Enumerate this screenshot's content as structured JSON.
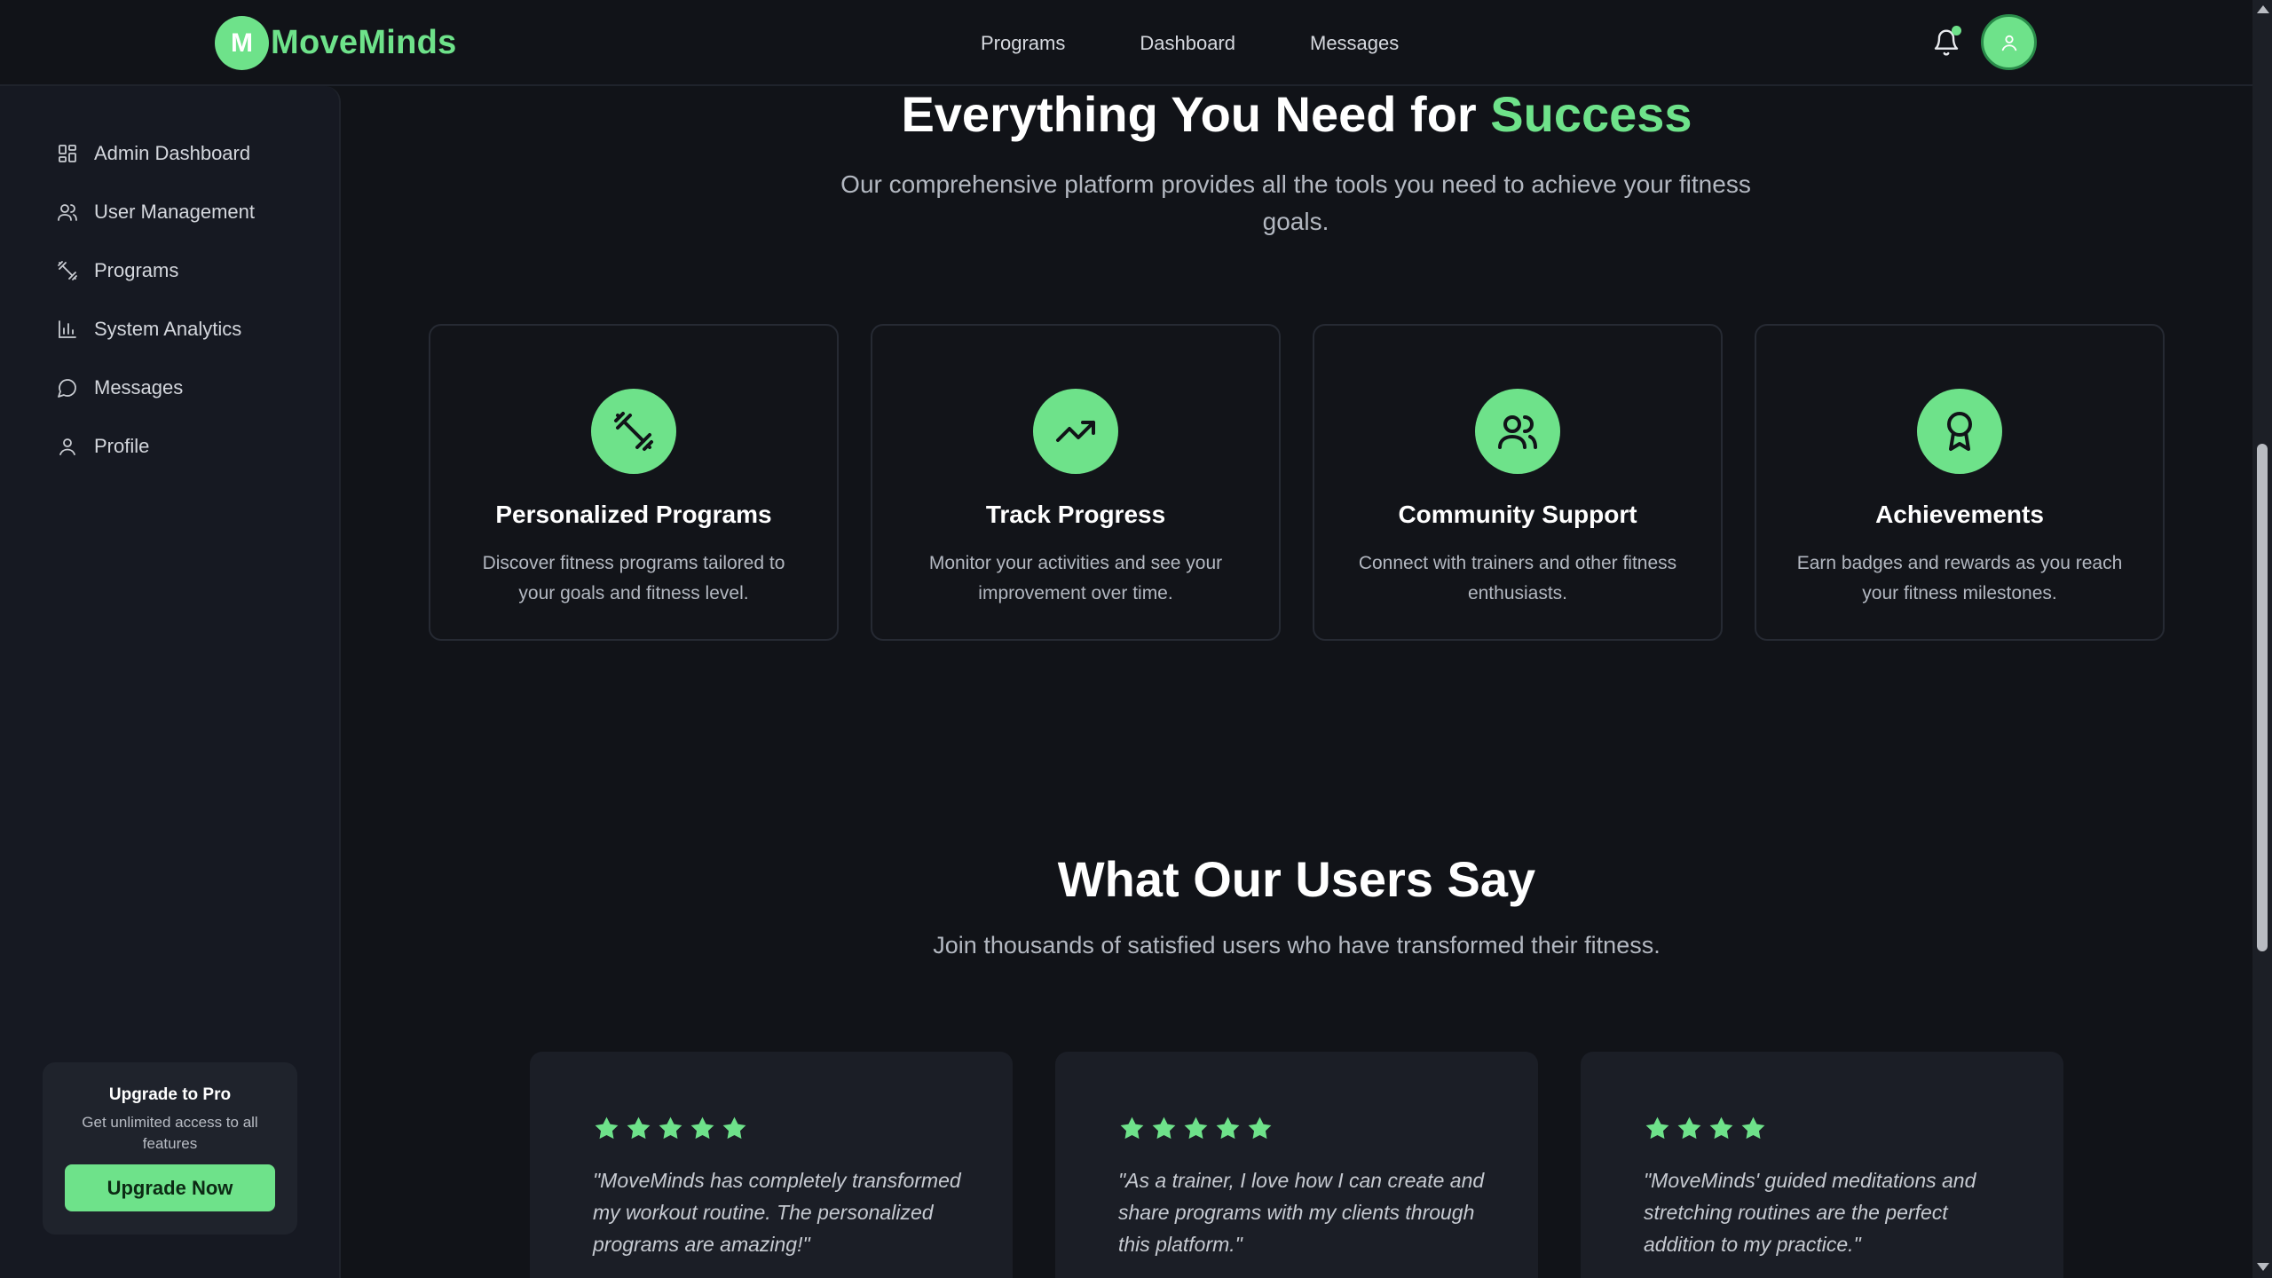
{
  "brand": {
    "badge": "M",
    "name": "MoveMinds"
  },
  "nav": {
    "links": [
      "Programs",
      "Dashboard",
      "Messages"
    ]
  },
  "colors": {
    "accent": "#6ee28a",
    "background": "#111318",
    "card": "#1b1e26"
  },
  "sidebar": {
    "items": [
      {
        "label": "Admin Dashboard",
        "icon": "layout-grid-icon"
      },
      {
        "label": "User Management",
        "icon": "users-icon"
      },
      {
        "label": "Programs",
        "icon": "dumbbell-icon"
      },
      {
        "label": "System Analytics",
        "icon": "bar-chart-icon"
      },
      {
        "label": "Messages",
        "icon": "message-circle-icon"
      },
      {
        "label": "Profile",
        "icon": "user-icon"
      }
    ],
    "upgrade": {
      "title": "Upgrade to Pro",
      "text": "Get unlimited access to all features",
      "button": "Upgrade Now"
    }
  },
  "features": {
    "heading_prefix": "Everything You Need for ",
    "heading_accent": "Success",
    "subheading": "Our comprehensive platform provides all the tools you need to achieve your fitness goals.",
    "cards": [
      {
        "title": "Personalized Programs",
        "text": "Discover fitness programs tailored to your goals and fitness level.",
        "icon": "dumbbell-icon"
      },
      {
        "title": "Track Progress",
        "text": "Monitor your activities and see your improvement over time.",
        "icon": "trending-up-icon"
      },
      {
        "title": "Community Support",
        "text": "Connect with trainers and other fitness enthusiasts.",
        "icon": "users-icon"
      },
      {
        "title": "Achievements",
        "text": "Earn badges and rewards as you reach your fitness milestones.",
        "icon": "award-icon"
      }
    ]
  },
  "testimonials": {
    "heading": "What Our Users Say",
    "subheading": "Join thousands of satisfied users who have transformed their fitness.",
    "items": [
      {
        "rating": 5,
        "quote": "\"MoveMinds has completely transformed my workout routine. The personalized programs are amazing!\""
      },
      {
        "rating": 5,
        "quote": "\"As a trainer, I love how I can create and share programs with my clients through this platform.\""
      },
      {
        "rating": 4,
        "quote": "\"MoveMinds' guided meditations and stretching routines are the perfect addition to my practice.\""
      }
    ]
  }
}
